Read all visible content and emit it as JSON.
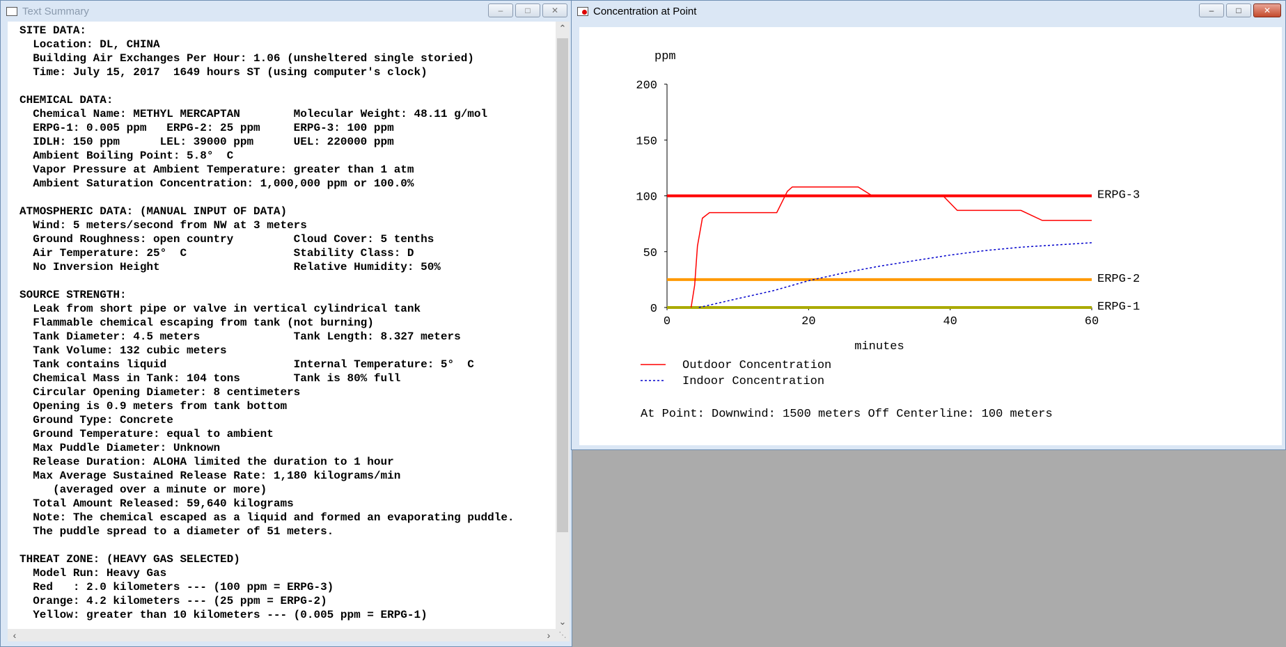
{
  "summary_window": {
    "title": "Text Summary",
    "lines": [
      "SITE DATA:",
      "  Location: DL, CHINA",
      "  Building Air Exchanges Per Hour: 1.06 (unsheltered single storied)",
      "  Time: July 15, 2017  1649 hours ST (using computer's clock)",
      "",
      "CHEMICAL DATA:",
      "  Chemical Name: METHYL MERCAPTAN        Molecular Weight: 48.11 g/mol",
      "  ERPG-1: 0.005 ppm   ERPG-2: 25 ppm     ERPG-3: 100 ppm",
      "  IDLH: 150 ppm      LEL: 39000 ppm      UEL: 220000 ppm",
      "  Ambient Boiling Point: 5.8°  C",
      "  Vapor Pressure at Ambient Temperature: greater than 1 atm",
      "  Ambient Saturation Concentration: 1,000,000 ppm or 100.0%",
      "",
      "ATMOSPHERIC DATA: (MANUAL INPUT OF DATA)",
      "  Wind: 5 meters/second from NW at 3 meters",
      "  Ground Roughness: open country         Cloud Cover: 5 tenths",
      "  Air Temperature: 25°  C                Stability Class: D",
      "  No Inversion Height                    Relative Humidity: 50%",
      "",
      "SOURCE STRENGTH:",
      "  Leak from short pipe or valve in vertical cylindrical tank",
      "  Flammable chemical escaping from tank (not burning)",
      "  Tank Diameter: 4.5 meters              Tank Length: 8.327 meters",
      "  Tank Volume: 132 cubic meters",
      "  Tank contains liquid                   Internal Temperature: 5°  C",
      "  Chemical Mass in Tank: 104 tons        Tank is 80% full",
      "  Circular Opening Diameter: 8 centimeters",
      "  Opening is 0.9 meters from tank bottom",
      "  Ground Type: Concrete",
      "  Ground Temperature: equal to ambient",
      "  Max Puddle Diameter: Unknown",
      "  Release Duration: ALOHA limited the duration to 1 hour",
      "  Max Average Sustained Release Rate: 1,180 kilograms/min",
      "     (averaged over a minute or more)",
      "  Total Amount Released: 59,640 kilograms",
      "  Note: The chemical escaped as a liquid and formed an evaporating puddle.",
      "  The puddle spread to a diameter of 51 meters.",
      "",
      "THREAT ZONE: (HEAVY GAS SELECTED)",
      "  Model Run: Heavy Gas",
      "  Red   : 2.0 kilometers --- (100 ppm = ERPG-3)",
      "  Orange: 4.2 kilometers --- (25 ppm = ERPG-2)",
      "  Yellow: greater than 10 kilometers --- (0.005 ppm = ERPG-1)"
    ]
  },
  "chart_window": {
    "title": "Concentration at Point"
  },
  "chart_data": {
    "type": "line",
    "ylabel": "ppm",
    "xlabel": "minutes",
    "xlim": [
      0,
      60
    ],
    "ylim": [
      0,
      200
    ],
    "xticks": [
      "0",
      "20",
      "40",
      "60"
    ],
    "yticks": [
      "0",
      "50",
      "100",
      "150",
      "200"
    ],
    "series": [
      {
        "name": "Outdoor Concentration",
        "color": "#ff0000",
        "style": "solid",
        "points": [
          [
            3.4,
            0
          ],
          [
            3.9,
            20
          ],
          [
            4.3,
            55
          ],
          [
            5.0,
            80
          ],
          [
            6,
            85
          ],
          [
            15.5,
            85
          ],
          [
            17,
            104
          ],
          [
            17.7,
            108
          ],
          [
            27,
            108
          ],
          [
            29,
            100
          ],
          [
            39,
            100
          ],
          [
            41,
            87
          ],
          [
            50,
            87
          ],
          [
            53,
            78
          ],
          [
            60,
            78
          ]
        ]
      },
      {
        "name": "Indoor Concentration",
        "color": "#0000cc",
        "style": "dotted",
        "points": [
          [
            4.5,
            0
          ],
          [
            10,
            8
          ],
          [
            15,
            15
          ],
          [
            20,
            24
          ],
          [
            25,
            31
          ],
          [
            30,
            37
          ],
          [
            35,
            42
          ],
          [
            40,
            47
          ],
          [
            45,
            51
          ],
          [
            50,
            54
          ],
          [
            55,
            56
          ],
          [
            60,
            58
          ]
        ]
      }
    ],
    "thresholds": [
      {
        "label": "ERPG-3",
        "value": 100,
        "color": "#ff0000"
      },
      {
        "label": "ERPG-2",
        "value": 25,
        "color": "#ff9900"
      },
      {
        "label": "ERPG-1",
        "value": 0.005,
        "color": "#aaaa00"
      }
    ],
    "legend": [
      {
        "label": "Outdoor Concentration"
      },
      {
        "label": "Indoor Concentration"
      }
    ],
    "footer": "At Point:   Downwind: 1500 meters   Off Centerline: 100 meters"
  }
}
